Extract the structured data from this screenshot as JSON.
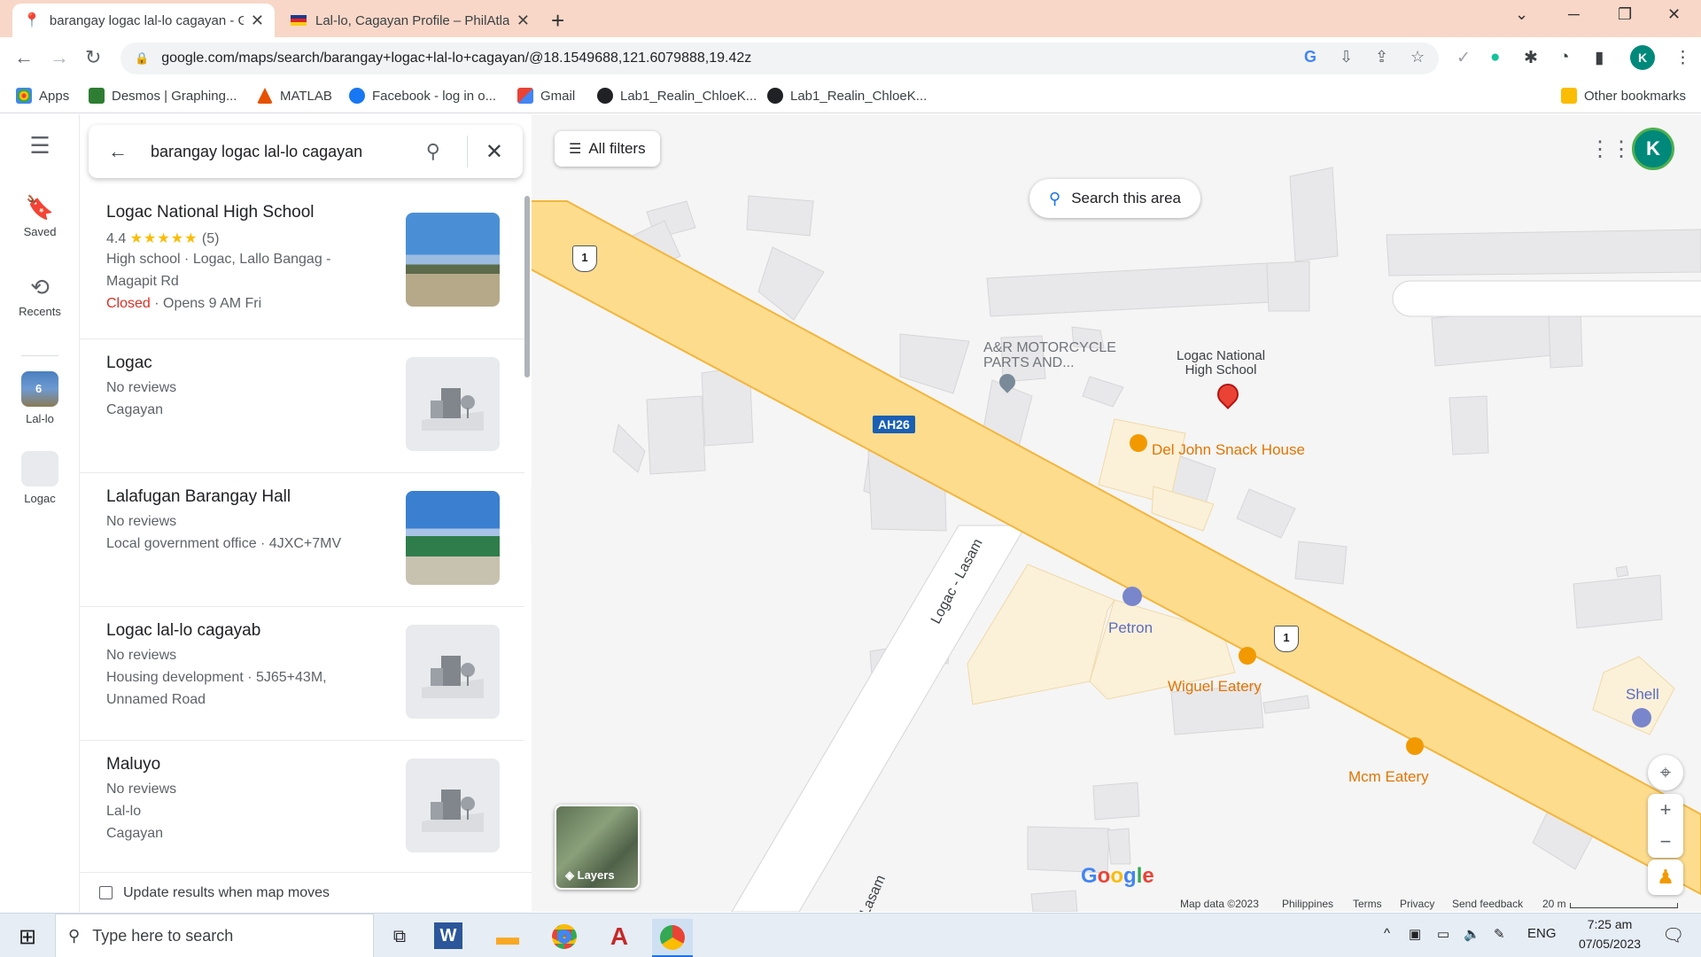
{
  "browser": {
    "tabs": [
      {
        "title": "barangay logac lal-lo cagayan - Go",
        "active": true
      },
      {
        "title": "Lal-lo, Cagayan Profile – PhilAtlas",
        "active": false
      }
    ],
    "url": "google.com/maps/search/barangay+logac+lal-lo+cagayan/@18.1549688,121.6079888,19.42z",
    "profile_initial": "K",
    "bookmarks": [
      {
        "label": "Apps",
        "icon_color": "#4285f4"
      },
      {
        "label": "Desmos | Graphing...",
        "icon_color": "#2e7d32"
      },
      {
        "label": "MATLAB",
        "icon_color": "#e65100"
      },
      {
        "label": "Facebook - log in o...",
        "icon_color": "#1877f2"
      },
      {
        "label": "Gmail",
        "icon_color": "#ea4335"
      },
      {
        "label": "Lab1_Realin_ChloeK...",
        "icon_color": "#202124"
      },
      {
        "label": "Lab1_Realin_ChloeK...",
        "icon_color": "#202124"
      }
    ],
    "other_bookmarks": "Other bookmarks"
  },
  "rail": {
    "saved": "Saved",
    "recents": "Recents",
    "recent_places": [
      {
        "label": "Lal-lo",
        "badge": "6"
      },
      {
        "label": "Logac"
      }
    ]
  },
  "search": {
    "query": "barangay logac lal-lo cagayan",
    "results": [
      {
        "name": "Logac National High School",
        "rating": "4.4",
        "stars": "★★★★★",
        "review_count": "(5)",
        "line1": "High school · Logac, Lallo Bangag -",
        "line2": "Magapit Rd",
        "status": "Closed",
        "status_detail": " · Opens 9 AM Fri",
        "thumb": "photo-school"
      },
      {
        "name": "Logac",
        "line1": "No reviews",
        "line2": "Cagayan",
        "thumb": "placeholder"
      },
      {
        "name": "Lalafugan Barangay Hall",
        "line1": "No reviews",
        "line2": "Local government office · 4JXC+7MV",
        "thumb": "photo-hall"
      },
      {
        "name": "Logac lal-lo cagayab",
        "line1": "No reviews",
        "line2": "Housing development · 5J65+43M,",
        "line3": "Unnamed Road",
        "thumb": "placeholder"
      },
      {
        "name": "Maluyo",
        "line1": "No reviews",
        "line2": "Lal-lo",
        "line3": "Cagayan",
        "thumb": "placeholder"
      }
    ],
    "update_results_label": "Update results when map moves"
  },
  "map": {
    "all_filters": "All filters",
    "search_this_area": "Search this area",
    "avatar_initial": "K",
    "layers_label": "Layers",
    "route_shield_1": "1",
    "route_ah": "AH26",
    "road_label": "Logac - Lasam",
    "road_label_2": "Lasam",
    "places": {
      "motorcycle": "A&R MOTORCYCLE\nPARTS AND...",
      "school": "Logac National\nHigh School",
      "snack": "Del John Snack House",
      "petron": "Petron",
      "wiguel": "Wiguel Eatery",
      "mcm": "Mcm Eatery",
      "shell": "Shell"
    },
    "google": "Google",
    "attribution": {
      "map_data": "Map data ©2023",
      "country": "Philippines",
      "terms": "Terms",
      "privacy": "Privacy",
      "feedback": "Send feedback",
      "scale": "20 m"
    }
  },
  "taskbar": {
    "search_placeholder": "Type here to search",
    "language": "ENG",
    "time": "7:25 am",
    "date": "07/05/2023"
  }
}
